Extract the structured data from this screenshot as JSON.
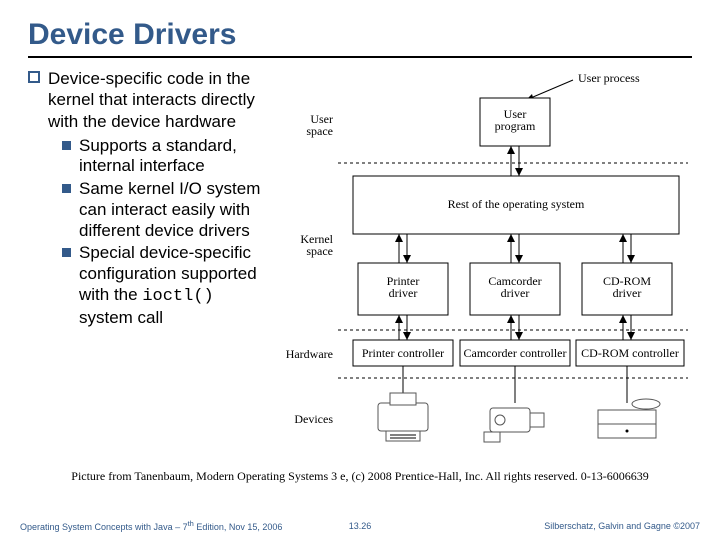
{
  "title": "Device Drivers",
  "bullet": {
    "text": "Device-specific code in the kernel that interacts directly with the device hardware",
    "subs": [
      "Supports a standard, internal interface",
      "Same kernel I/O system can interact easily with different device drivers",
      "Special device-specific configuration supported with the"
    ],
    "ioctl": "ioctl()",
    "tail": " system call"
  },
  "diagram": {
    "side": {
      "user": "User\nspace",
      "kernel": "Kernel\nspace",
      "hardware": "Hardware",
      "devices": "Devices"
    },
    "user_process": "User process",
    "user_program": "User\nprogram",
    "rest_os": "Rest of the operating system",
    "drivers": [
      "Printer\ndriver",
      "Camcorder\ndriver",
      "CD-ROM\ndriver"
    ],
    "controllers": [
      "Printer controller",
      "Camcorder controller",
      "CD-ROM controller"
    ]
  },
  "caption": "Picture from Tanenbaum, Modern Operating Systems 3 e, (c) 2008 Prentice-Hall, Inc. All rights reserved. 0-13-6006639",
  "footer": {
    "left_a": "Operating System Concepts with Java – 7",
    "left_sup": "th",
    "left_b": " Edition, Nov 15, 2006",
    "center": "13.26",
    "right": "Silberschatz, Galvin and Gagne ©2007"
  }
}
